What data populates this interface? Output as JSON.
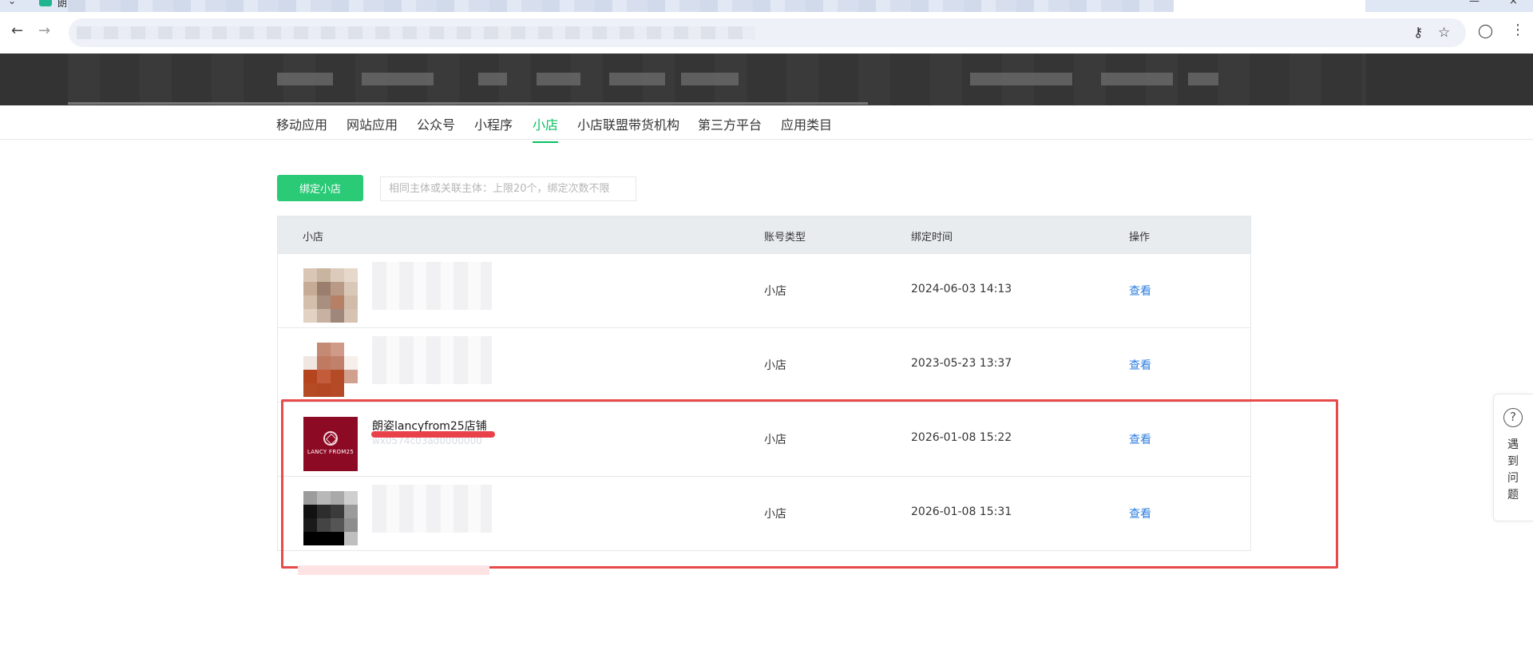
{
  "browser": {
    "tab_title": "朗",
    "win_controls": [
      "—",
      "×"
    ],
    "back_icon": "←",
    "forward_icon": "→",
    "key_icon": "⚷",
    "star_icon": "☆",
    "profile_icon": "◯",
    "menu_icon": "⋮"
  },
  "categories": [
    "移动应用",
    "网站应用",
    "公众号",
    "小程序",
    "小店",
    "小店联盟带货机构",
    "第三方平台",
    "应用类目"
  ],
  "active_category": "小店",
  "bind": {
    "button_label": "绑定小店",
    "tip": "相同主体或关联主体：上限20个，绑定次数不限"
  },
  "table": {
    "headers": [
      "小店",
      "账号类型",
      "绑定时间",
      "操作"
    ],
    "rows": [
      {
        "name": "",
        "type": "小店",
        "time": "2024-06-03 14:13",
        "action": "查看",
        "thumb": "mosaic-beige"
      },
      {
        "name": "",
        "type": "小店",
        "time": "2023-05-23 13:37",
        "action": "查看",
        "thumb": "mosaic-orange"
      },
      {
        "name": "朗姿lancyfrom25店铺",
        "id": "wx0574c03ad0000000",
        "type": "小店",
        "time": "2026-01-08 15:22",
        "action": "查看",
        "thumb": "logo-red",
        "logo_text": "LANCY FROM25"
      },
      {
        "name": "",
        "type": "小店",
        "time": "2026-01-08 15:31",
        "action": "查看",
        "thumb": "mosaic-black"
      }
    ]
  },
  "help": {
    "icon": "?",
    "label": "遇到问题"
  },
  "colors": {
    "accent": "#07c160",
    "link": "#2b7de1",
    "annotation": "#e84a4a"
  }
}
